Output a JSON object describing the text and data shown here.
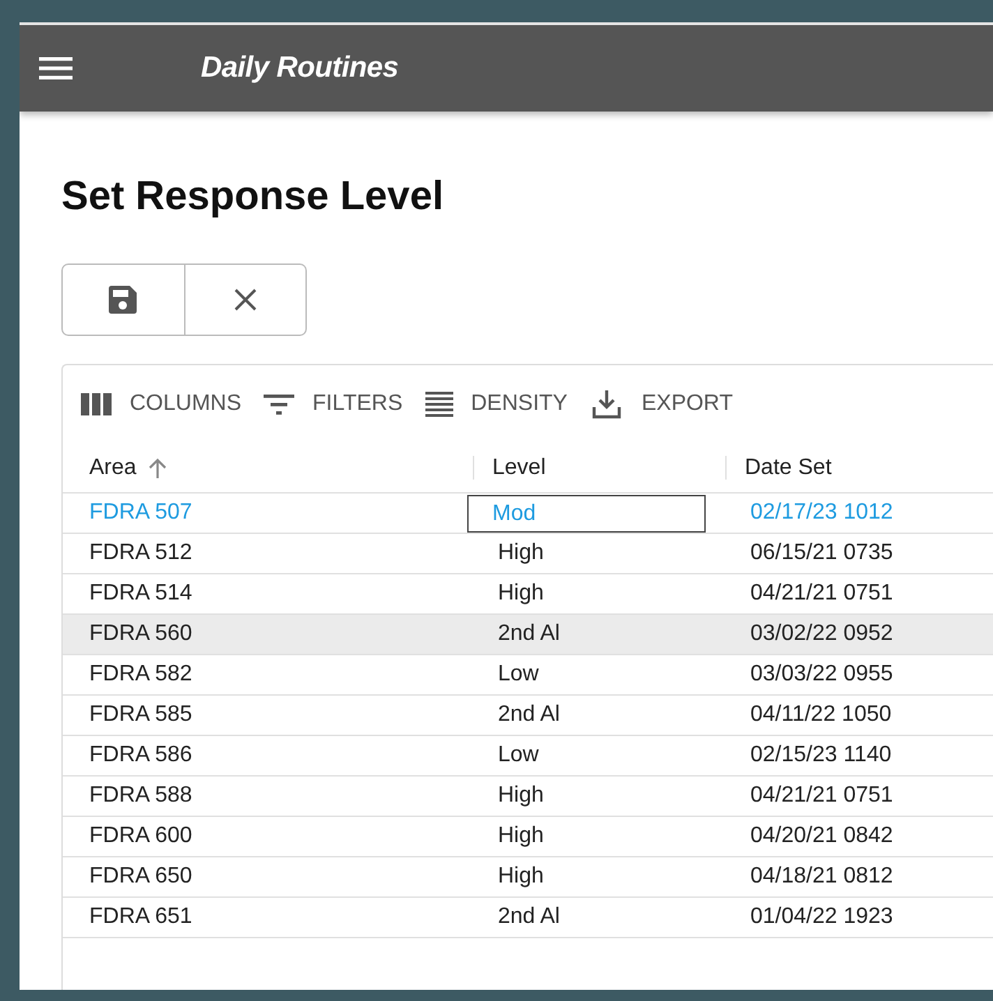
{
  "app_bar": {
    "title": "Daily Routines"
  },
  "page": {
    "title": "Set Response Level"
  },
  "actions": [
    {
      "kind": "save"
    },
    {
      "kind": "cancel"
    }
  ],
  "grid_toolbar": [
    {
      "kind": "columns",
      "label": "COLUMNS"
    },
    {
      "kind": "filters",
      "label": "FILTERS"
    },
    {
      "kind": "density",
      "label": "DENSITY"
    },
    {
      "kind": "export",
      "label": "EXPORT"
    }
  ],
  "table": {
    "columns": [
      {
        "label": "Area",
        "sorted_ascending": true
      },
      {
        "label": "Level",
        "sorted_ascending": false
      },
      {
        "label": "Date Set",
        "sorted_ascending": false
      }
    ],
    "rows": [
      {
        "area": "FDRA 507",
        "level": "Mod",
        "date_set": "02/17/23 1012",
        "selected": true,
        "hovered": false,
        "level_focused": true
      },
      {
        "area": "FDRA 512",
        "level": "High",
        "date_set": "06/15/21 0735",
        "selected": false,
        "hovered": false,
        "level_focused": false
      },
      {
        "area": "FDRA 514",
        "level": "High",
        "date_set": "04/21/21 0751",
        "selected": false,
        "hovered": false,
        "level_focused": false
      },
      {
        "area": "FDRA 560",
        "level": "2nd Al",
        "date_set": "03/02/22 0952",
        "selected": false,
        "hovered": true,
        "level_focused": false
      },
      {
        "area": "FDRA 582",
        "level": "Low",
        "date_set": "03/03/22 0955",
        "selected": false,
        "hovered": false,
        "level_focused": false
      },
      {
        "area": "FDRA 585",
        "level": "2nd Al",
        "date_set": "04/11/22 1050",
        "selected": false,
        "hovered": false,
        "level_focused": false
      },
      {
        "area": "FDRA 586",
        "level": "Low",
        "date_set": "02/15/23 1140",
        "selected": false,
        "hovered": false,
        "level_focused": false
      },
      {
        "area": "FDRA 588",
        "level": "High",
        "date_set": "04/21/21 0751",
        "selected": false,
        "hovered": false,
        "level_focused": false
      },
      {
        "area": "FDRA 600",
        "level": "High",
        "date_set": "04/20/21 0842",
        "selected": false,
        "hovered": false,
        "level_focused": false
      },
      {
        "area": "FDRA 650",
        "level": "High",
        "date_set": "04/18/21 0812",
        "selected": false,
        "hovered": false,
        "level_focused": false
      },
      {
        "area": "FDRA 651",
        "level": "2nd Al",
        "date_set": "01/04/22 1923",
        "selected": false,
        "hovered": false,
        "level_focused": false
      }
    ]
  }
}
